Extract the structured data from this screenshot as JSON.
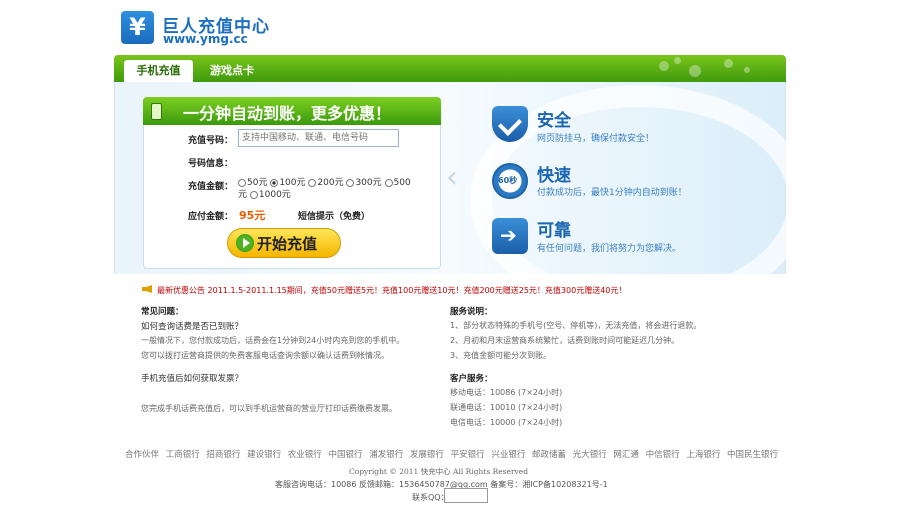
{
  "brand": {
    "logo_glyph": "¥",
    "name": "巨人充值中心",
    "url": "www.ymg.cc"
  },
  "nav": {
    "tabs": [
      {
        "label": "手机充值",
        "active": true
      },
      {
        "label": "游戏点卡",
        "active": false
      }
    ]
  },
  "form": {
    "title": "一分钟自动到账，更多优惠！",
    "phone_label": "充值号码：",
    "phone_placeholder": "支持中国移动、联通、电信号码",
    "info_label": "号码信息：",
    "amount_label": "充值金额：",
    "amounts": [
      "50元",
      "100元",
      "200元",
      "300元",
      "500元",
      "1000元"
    ],
    "selected_amount": "100元",
    "pay_label": "应付金额：",
    "pay_value": "95元",
    "sms_tip": "短信提示（免费）",
    "submit_label": "开始充值"
  },
  "features": [
    {
      "icon": "shield-check-icon",
      "title": "安全",
      "desc": "网页防挂马，确保付款安全！"
    },
    {
      "icon": "stopwatch-icon",
      "icon_text": "60秒",
      "title": "快速",
      "desc": "付款成功后，最快1分钟内自动到账！"
    },
    {
      "icon": "arrow-right-icon",
      "title": "可靠",
      "desc": "有任何问题，我们将努力为您解决。"
    }
  ],
  "notice": "最新优惠公告 2011.1.5-2011.1.15期间，充值50元赠送5元！充值100元赠送10元！充值200元赠送25元！充值300元赠送40元！",
  "faq": {
    "title": "常见问题：",
    "q1": "如何查询话费是否已到账？",
    "a1_line1": "一般情况下，您付款成功后，话费会在1分钟到24小时内充到您的手机中。",
    "a1_line2": "您可以拨打运营商提供的免费客服电话查询余额以确认话费到帐情况。",
    "q2": "手机充值后如何获取发票？",
    "a2": "您完成手机话费充值后，可以到手机运营商的营业厅打印话费缴费发票。"
  },
  "service": {
    "title": "服务说明：",
    "items": [
      "1、部分状态特殊的手机号(空号、停机等)，无法充值，将会进行退款。",
      "2、月初和月末运营商系统繁忙，话费到账时间可能延迟几分钟。",
      "3、充值金额可能分次到账。"
    ],
    "cs_title": "客户服务：",
    "cs_items": [
      "移动电话：10086  (7×24小时)",
      "联通电话：10010  (7×24小时)",
      "电信电话：10000  (7×24小时)"
    ]
  },
  "footer": {
    "banks": "合作伙伴 工商银行 招商银行 建设银行 农业银行 中国银行 浦发银行 发展银行 平安银行 兴业银行 邮政储蓄 光大银行 网汇通 中信银行 上海银行 中国民生银行",
    "copyright": "Copyright © 2011 快充中心 All Rights Reserved",
    "contact": "客服咨询电话：10086  反馈邮箱：1536450787@qq.com     备案号：湘ICP备10208321号-1",
    "qq_label": "联系QQ："
  }
}
